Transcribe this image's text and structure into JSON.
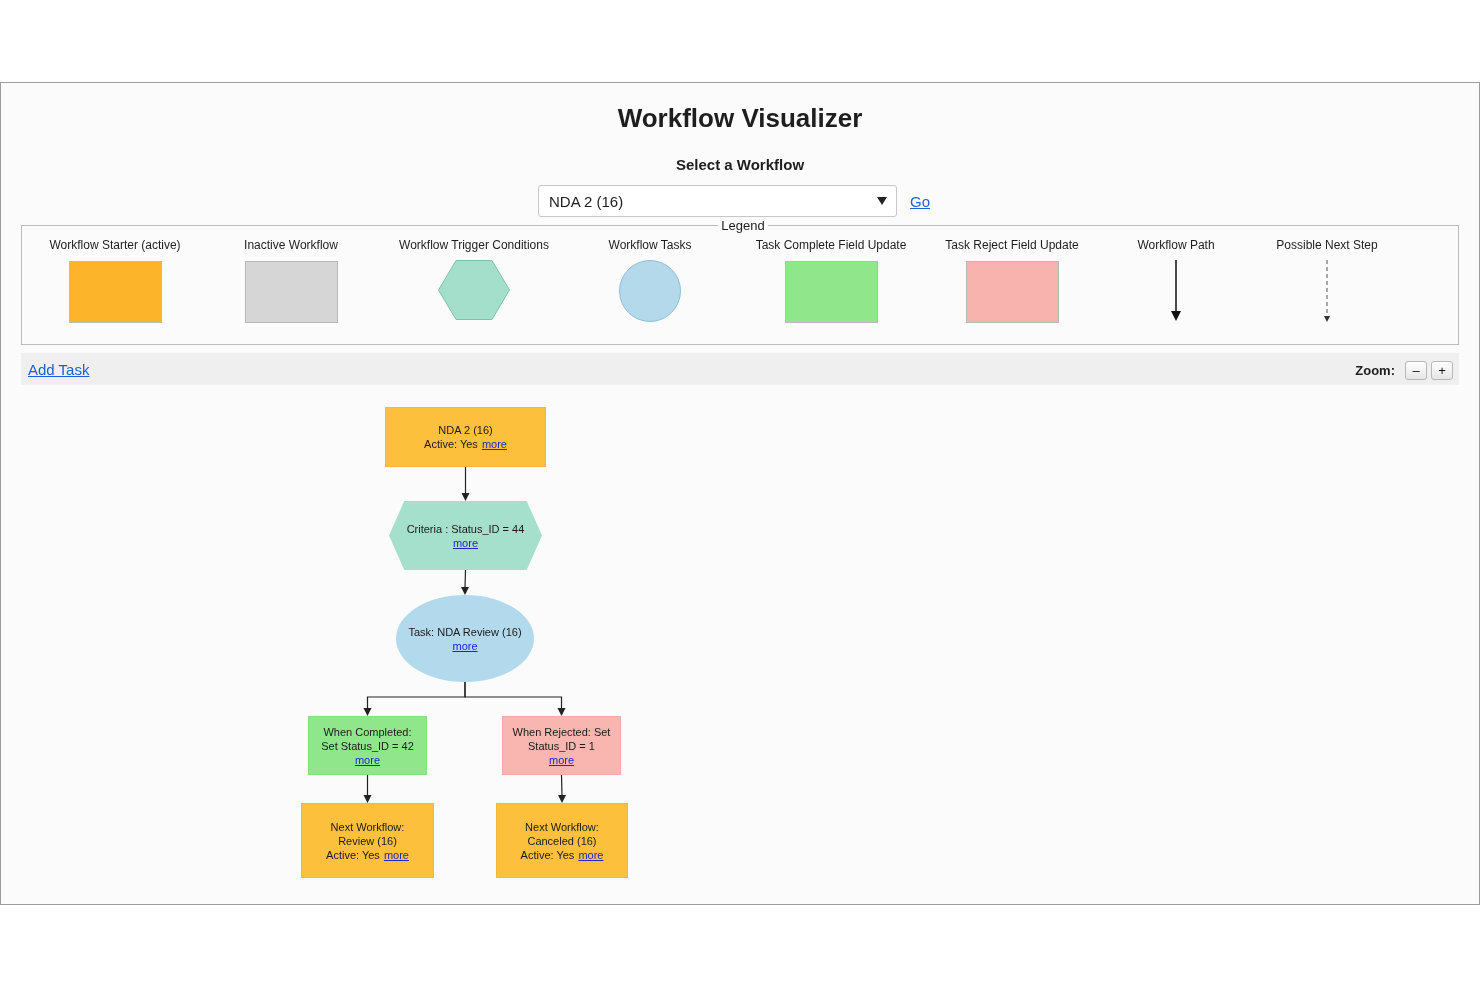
{
  "page": {
    "title": "Workflow Visualizer"
  },
  "workflow_select": {
    "label": "Select a Workflow",
    "value": "NDA 2 (16)",
    "go_link": "Go"
  },
  "legend": {
    "title": "Legend",
    "items": [
      {
        "label": "Workflow Starter (active)",
        "kind": "rect",
        "color": "#fcb52b"
      },
      {
        "label": "Inactive Workflow",
        "kind": "rect",
        "color": "#d6d6d6"
      },
      {
        "label": "Workflow Trigger Conditions",
        "kind": "hexagon",
        "color": "#a4dfcb"
      },
      {
        "label": "Workflow Tasks",
        "kind": "circle",
        "color": "#b3d9eb"
      },
      {
        "label": "Task Complete Field Update",
        "kind": "rect",
        "color": "#8fe68b"
      },
      {
        "label": "Task Reject Field Update",
        "kind": "rect",
        "color": "#f9b3ae"
      },
      {
        "label": "Workflow Path",
        "kind": "solid-arrow"
      },
      {
        "label": "Possible Next Step",
        "kind": "dashed-arrow"
      }
    ]
  },
  "toolbar": {
    "add_task_link": "Add Task",
    "zoom_label": "Zoom:",
    "zoom_buttons": [
      "–",
      "+"
    ]
  },
  "diagram": {
    "root": {
      "kind": "workflow",
      "color": "#fcc03c",
      "lines": [
        "NDA 2 (16)",
        "Active: Yes"
      ],
      "link": "more",
      "children": [
        {
          "kind": "criteria",
          "color": "#a4e0cb",
          "lines": [
            "Criteria : Status_ID = 44"
          ],
          "link": "more",
          "children": [
            {
              "kind": "task",
              "color": "#b3daec",
              "lines": [
                "Task: NDA Review (16)"
              ],
              "link": "more",
              "children": [
                {
                  "kind": "field-update",
                  "color": "#90e68b",
                  "lines": [
                    "When Completed:",
                    "Set Status_ID = 42"
                  ],
                  "link": "more",
                  "children": [
                    {
                      "kind": "workflow",
                      "color": "#fcc03c",
                      "lines": [
                        "Next Workflow:",
                        "Review (16)",
                        "Active: Yes"
                      ],
                      "link": "more"
                    }
                  ]
                },
                {
                  "kind": "field-update",
                  "color": "#f9b5b0",
                  "lines": [
                    "When Rejected: Set",
                    "Status_ID = 1"
                  ],
                  "link": "more",
                  "children": [
                    {
                      "kind": "workflow",
                      "color": "#fcc03c",
                      "lines": [
                        "Next Workflow:",
                        "Canceled (16)",
                        "Active: Yes"
                      ],
                      "link": "more"
                    }
                  ]
                }
              ]
            }
          ]
        }
      ]
    }
  }
}
